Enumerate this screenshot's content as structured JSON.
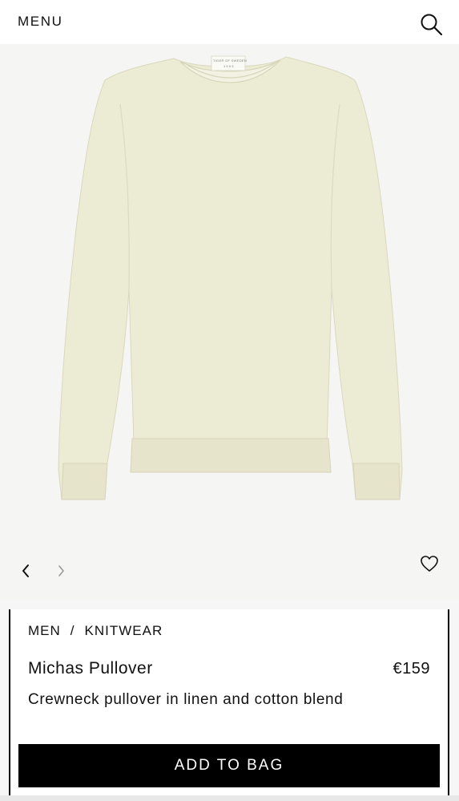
{
  "header": {
    "menu_label": "MENU",
    "search_icon": "search-icon"
  },
  "gallery": {
    "image_subject": "cream crewneck knit pullover",
    "neck_label_text": [
      "TIGER OF SWEDEN",
      "1903"
    ],
    "prev_icon": "chevron-left-icon",
    "next_icon": "chevron-right-icon",
    "favorite_icon": "heart-icon"
  },
  "product": {
    "breadcrumb": [
      "MEN",
      "KNITWEAR"
    ],
    "breadcrumb_separator": "/",
    "title": "Michas Pullover",
    "price": "€159",
    "description": "Crewneck pullover in linen and cotton blend",
    "add_to_bag_label": "ADD TO BAG"
  },
  "colors": {
    "garment": "#ecebd3",
    "button": "#000000",
    "background": "#f5f5f4"
  }
}
